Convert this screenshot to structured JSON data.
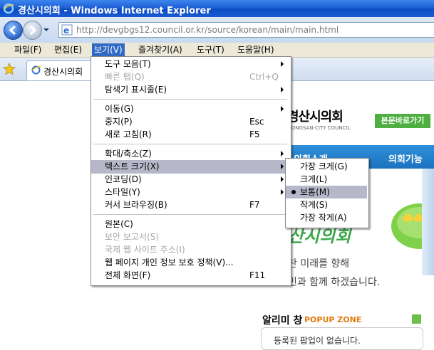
{
  "window": {
    "title": "경산시의회 - Windows Internet Explorer"
  },
  "address": {
    "url": "http://devgbgs12.council.or.kr/source/korean/main/main.html"
  },
  "menubar": [
    {
      "label": "파일(F)"
    },
    {
      "label": "편집(E)"
    },
    {
      "label": "보기(V)",
      "active": true
    },
    {
      "label": "즐겨찾기(A)"
    },
    {
      "label": "도구(T)"
    },
    {
      "label": "도움말(H)"
    }
  ],
  "tab": {
    "label": "경산시의회"
  },
  "view_menu": {
    "items": [
      {
        "label": "도구 모음(T)",
        "submenu": true
      },
      {
        "label": "빠른 탭(Q)",
        "shortcut": "Ctrl+Q",
        "disabled": true
      },
      {
        "label": "탐색기 표시줄(E)",
        "submenu": true
      },
      {
        "label": "이동(G)",
        "submenu": true
      },
      {
        "label": "중지(P)",
        "shortcut": "Esc"
      },
      {
        "label": "새로 고침(R)",
        "shortcut": "F5"
      },
      {
        "label": "확대/축소(Z)",
        "submenu": true
      },
      {
        "label": "텍스트 크기(X)",
        "submenu": true,
        "highlighted": true
      },
      {
        "label": "인코딩(D)",
        "submenu": true
      },
      {
        "label": "스타일(Y)",
        "submenu": true
      },
      {
        "label": "커서 브라우징(B)",
        "shortcut": "F7"
      },
      {
        "label": "원본(C)"
      },
      {
        "label": "보안 보고서(S)",
        "disabled": true
      },
      {
        "label": "국제 웹 사이트 주소(I)",
        "disabled": true
      },
      {
        "label": "웹 페이지 개인 정보 보호 정책(V)..."
      },
      {
        "label": "전체 화면(F)",
        "shortcut": "F11"
      }
    ]
  },
  "text_size_menu": {
    "items": [
      {
        "label": "가장 크게(G)"
      },
      {
        "label": "크게(L)"
      },
      {
        "label": "보통(M)",
        "selected": true
      },
      {
        "label": "작게(S)"
      },
      {
        "label": "가장 작게(A)"
      }
    ]
  },
  "page": {
    "logo": "경산시의회",
    "logo_sub": "YEONGSAN-CITY COUNCIL",
    "skip_button": "본문바로가기",
    "nav": [
      "의회소개",
      "의회기능"
    ],
    "hero_title": "산시의회",
    "hero_line1": "찬 미래를 향해",
    "hero_line2": "민과 함께 하겠습니다.",
    "popup_title": "알리미 창",
    "popup_sub": "POPUP ZONE",
    "popup_empty": "등록된 팝업이 없습니다."
  },
  "colors": {
    "titlebar": "#1d5fd4",
    "menu_highlight": "#b6b7c8",
    "nav_blue": "#2f8fd8",
    "green": "#4caf3f"
  }
}
